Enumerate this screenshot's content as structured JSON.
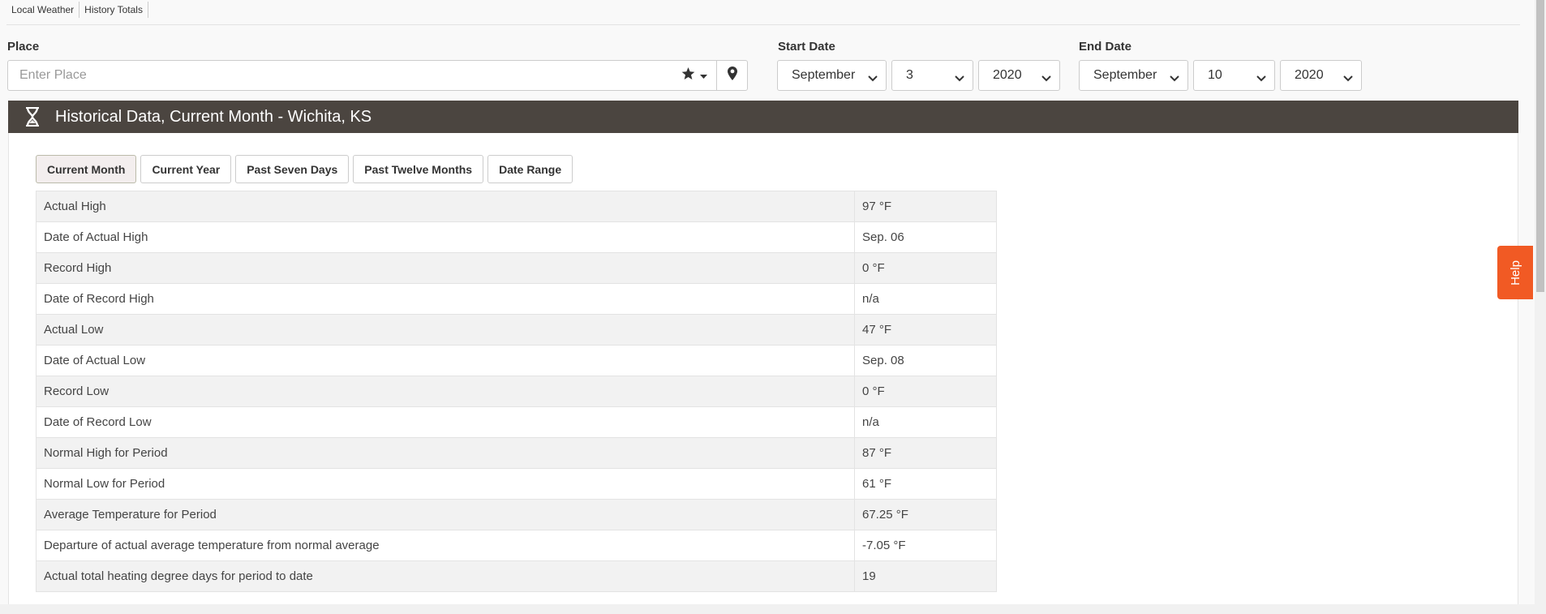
{
  "topnav": {
    "local_weather": "Local Weather",
    "history_totals": "History Totals"
  },
  "form": {
    "place_label": "Place",
    "place_placeholder": "Enter Place",
    "start_date_label": "Start Date",
    "end_date_label": "End Date",
    "start_month": "September",
    "start_day": "3",
    "start_year": "2020",
    "end_month": "September",
    "end_day": "10",
    "end_year": "2020"
  },
  "panel": {
    "title": "Historical Data, Current Month - Wichita, KS"
  },
  "tabs": [
    {
      "label": "Current Month"
    },
    {
      "label": "Current Year"
    },
    {
      "label": "Past Seven Days"
    },
    {
      "label": "Past Twelve Months"
    },
    {
      "label": "Date Range"
    }
  ],
  "table": {
    "rows": [
      {
        "label": "Actual High",
        "value": "97 °F"
      },
      {
        "label": "Date of Actual High",
        "value": "Sep. 06"
      },
      {
        "label": "Record High",
        "value": "0 °F"
      },
      {
        "label": "Date of Record High",
        "value": "n/a"
      },
      {
        "label": "Actual Low",
        "value": "47 °F"
      },
      {
        "label": "Date of Actual Low",
        "value": "Sep. 08"
      },
      {
        "label": "Record Low",
        "value": "0 °F"
      },
      {
        "label": "Date of Record Low",
        "value": "n/a"
      },
      {
        "label": "Normal High for Period",
        "value": "87 °F"
      },
      {
        "label": "Normal Low for Period",
        "value": "61 °F"
      },
      {
        "label": "Average Temperature for Period",
        "value": "67.25 °F"
      },
      {
        "label": "Departure of actual average temperature from normal average",
        "value": "-7.05 °F"
      },
      {
        "label": "Actual total heating degree days for period to date",
        "value": "19"
      }
    ]
  },
  "help": {
    "label": "Help"
  },
  "colors": {
    "header_bg": "#4b4540",
    "help_bg": "#f15a24"
  }
}
